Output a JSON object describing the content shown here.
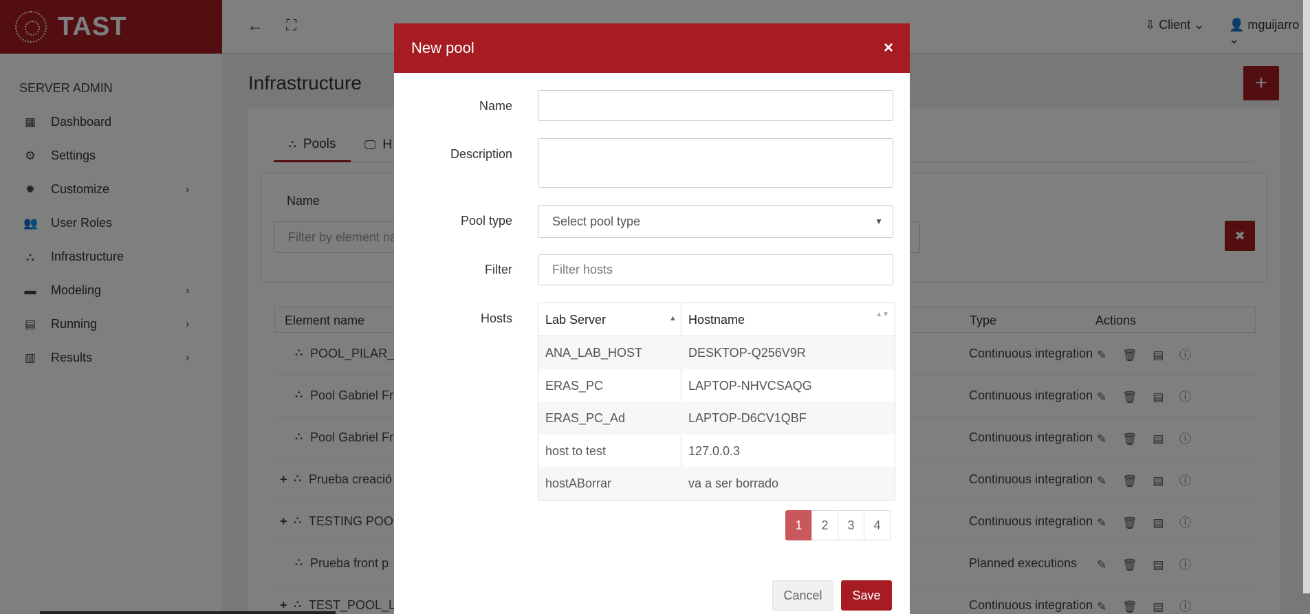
{
  "app": {
    "brand": "TAST"
  },
  "sidebar": {
    "section": "SERVER ADMIN",
    "items": [
      {
        "label": "Dashboard",
        "icon": "▦",
        "chevron": false
      },
      {
        "label": "Settings",
        "icon": "⚙",
        "chevron": false
      },
      {
        "label": "Customize",
        "icon": "✹",
        "chevron": true
      },
      {
        "label": "User Roles",
        "icon": "👥",
        "chevron": false
      },
      {
        "label": "Infrastructure",
        "icon": "⛬",
        "chevron": false
      },
      {
        "label": "Modeling",
        "icon": "▬",
        "chevron": true
      },
      {
        "label": "Running",
        "icon": "▤",
        "chevron": true
      },
      {
        "label": "Results",
        "icon": "▥",
        "chevron": true
      }
    ],
    "chevron_glyph": "›"
  },
  "topbar": {
    "back_glyph": "←",
    "expand_glyph": "⛶",
    "client_label": "⇩ Client ⌄",
    "user_label": "👤 mguijarro ⌄"
  },
  "main": {
    "title": "Infrastructure",
    "add_glyph": "+",
    "tabs": [
      {
        "label": "Pools",
        "icon": "⛬"
      },
      {
        "label": "H",
        "icon": "🖵"
      }
    ],
    "filter": {
      "label": "Name",
      "placeholder": "Filter by element na",
      "clear_glyph": "✖"
    },
    "table": {
      "headers": {
        "name": "Element name",
        "type": "Type",
        "actions": "Actions"
      },
      "rows": [
        {
          "expand": "",
          "name": "POOL_PILAR_",
          "type": "Continuous integration",
          "actions": "✎ 🗑 ▤ ⓘ"
        },
        {
          "expand": "",
          "name": "Pool Gabriel Fr",
          "type": "Continuous integration",
          "actions": "✎ 🗑 ▤ ⓘ"
        },
        {
          "expand": "",
          "name": "Pool Gabriel Fr",
          "type": "Continuous integration",
          "actions": "✎ 🗑 ▤ ⓘ"
        },
        {
          "expand": "+",
          "name": "Prueba creació",
          "type": "Continuous integration",
          "actions": "✎ 🗑 ▤ ⓘ"
        },
        {
          "expand": "+",
          "name": "TESTING POO",
          "type": "Continuous integration",
          "actions": "✎ 🗑 ▤ ⓘ"
        },
        {
          "expand": "",
          "name": "Prueba front p",
          "type": "Planned executions",
          "actions": "✎ 🗑 ▤ ⓘ"
        },
        {
          "expand": "+",
          "name": "TEST_POOL_L",
          "type": "Continuous integration",
          "actions": "✎ 🗑 ▤ ⓘ"
        }
      ],
      "pool_icon": "⛬"
    }
  },
  "modal": {
    "title": "New pool",
    "close_glyph": "×",
    "labels": {
      "name": "Name",
      "description": "Description",
      "pool_type": "Pool type",
      "filter": "Filter",
      "hosts": "Hosts"
    },
    "name_value": "",
    "description_value": "",
    "pool_type_selected": "Select pool type",
    "caret_glyph": "▼",
    "filter_placeholder": "Filter hosts",
    "hosts_table": {
      "headers": [
        "Lab Server",
        "Hostname"
      ],
      "sort_asc_glyph": "▲",
      "sort_both_glyph": "▲▼",
      "rows": [
        [
          "ANA_LAB_HOST",
          "DESKTOP-Q256V9R"
        ],
        [
          "ERAS_PC",
          "LAPTOP-NHVCSAQG"
        ],
        [
          "ERAS_PC_Ad",
          "LAPTOP-D6CV1QBF"
        ],
        [
          "host to test",
          "127.0.0.3"
        ],
        [
          "hostABorrar",
          "va a ser borrado"
        ]
      ]
    },
    "pagination": [
      "1",
      "2",
      "3",
      "4"
    ],
    "cancel_label": "Cancel",
    "save_label": "Save"
  }
}
